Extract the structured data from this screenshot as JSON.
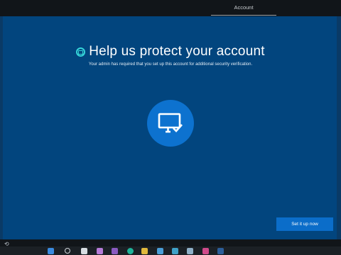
{
  "header": {
    "tab_label": "Account"
  },
  "main": {
    "title": "Help us protect your account",
    "subtitle": "Your admin has required that you set up this account for additional security verification.",
    "hero_icon": "monitor-check-icon",
    "org_logo_icon": "org-logo-icon"
  },
  "actions": {
    "setup_label": "Set it up now"
  },
  "footer": {
    "accessibility_icon": "ease-of-access-icon"
  },
  "taskbar": {
    "icons": [
      "start-icon",
      "search-icon",
      "file-explorer-icon",
      "notepad-icon",
      "edge-icon",
      "folder-icon",
      "mail-icon",
      "settings-icon",
      "network-icon",
      "store-icon"
    ]
  },
  "colors": {
    "background": "#02457e",
    "accent": "#0d72cf",
    "button": "#0b6dc9",
    "logo": "#35d4d8"
  }
}
